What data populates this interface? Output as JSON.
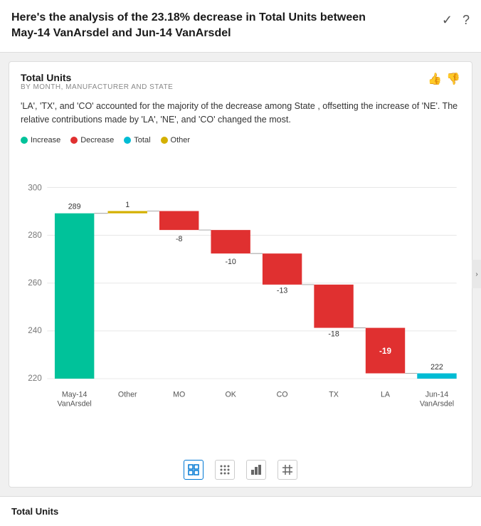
{
  "header": {
    "title": "Here's the analysis of the 23.18% decrease in Total Units between May-14 VanArsdel and Jun-14 VanArsdel",
    "check_icon": "✓",
    "help_icon": "?"
  },
  "card": {
    "title": "Total Units",
    "subtitle": "BY MONTH, MANUFACTURER AND STATE",
    "description": "'LA', 'TX', and 'CO' accounted for the majority of the decrease among State , offsetting the increase of 'NE'. The relative contributions made by 'LA', 'NE', and 'CO' changed the most.",
    "feedback_up": "👍",
    "feedback_down": "👎"
  },
  "legend": [
    {
      "label": "Increase",
      "color": "#00c29a"
    },
    {
      "label": "Decrease",
      "color": "#e03030"
    },
    {
      "label": "Total",
      "color": "#00bcd4"
    },
    {
      "label": "Other",
      "color": "#d4b000"
    }
  ],
  "chart": {
    "y_labels": [
      "220",
      "240",
      "260",
      "280",
      "300"
    ],
    "bars": [
      {
        "label": "May-14\nVanArsdel",
        "value": 289,
        "type": "total",
        "color": "#00c29a",
        "annotation": "289"
      },
      {
        "label": "Other",
        "value": 1,
        "type": "other",
        "color": "#d4b000",
        "annotation": "1"
      },
      {
        "label": "MO",
        "value": -8,
        "type": "decrease",
        "color": "#e03030",
        "annotation": "-8"
      },
      {
        "label": "OK",
        "value": -10,
        "type": "decrease",
        "color": "#e03030",
        "annotation": "-10"
      },
      {
        "label": "CO",
        "value": -13,
        "type": "decrease",
        "color": "#e03030",
        "annotation": "-13"
      },
      {
        "label": "TX",
        "value": -18,
        "type": "decrease",
        "color": "#e03030",
        "annotation": "-18"
      },
      {
        "label": "LA",
        "value": -19,
        "type": "decrease",
        "color": "#e03030",
        "annotation": "-19",
        "bold": true
      },
      {
        "label": "Jun-14\nVanArsdel",
        "value": 222,
        "type": "total",
        "color": "#00bcd4",
        "annotation": "222"
      }
    ]
  },
  "controls": [
    {
      "icon": "▦",
      "active": true,
      "label": "table-view"
    },
    {
      "icon": "⋮⋮",
      "active": false,
      "label": "dot-view"
    },
    {
      "icon": "📊",
      "active": false,
      "label": "bar-view"
    },
    {
      "icon": "🔲",
      "active": false,
      "label": "grid-view"
    }
  ],
  "bottom": {
    "label": "Total Units"
  }
}
